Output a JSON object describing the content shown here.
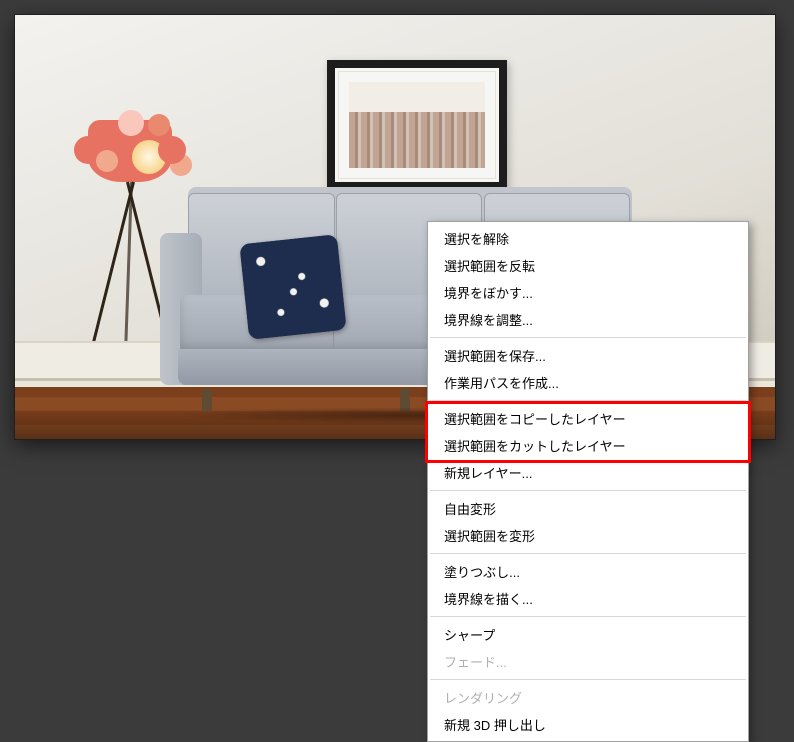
{
  "context_menu": {
    "items": [
      {
        "label": "選択を解除",
        "enabled": true,
        "sep_after": false
      },
      {
        "label": "選択範囲を反転",
        "enabled": true,
        "sep_after": false
      },
      {
        "label": "境界をぼかす...",
        "enabled": true,
        "sep_after": false
      },
      {
        "label": "境界線を調整...",
        "enabled": true,
        "sep_after": true
      },
      {
        "label": "選択範囲を保存...",
        "enabled": true,
        "sep_after": false
      },
      {
        "label": "作業用パスを作成...",
        "enabled": true,
        "sep_after": true
      },
      {
        "label": "選択範囲をコピーしたレイヤー",
        "enabled": true,
        "sep_after": false,
        "highlighted": true
      },
      {
        "label": "選択範囲をカットしたレイヤー",
        "enabled": true,
        "sep_after": false,
        "highlighted": true
      },
      {
        "label": "新規レイヤー...",
        "enabled": true,
        "sep_after": true
      },
      {
        "label": "自由変形",
        "enabled": true,
        "sep_after": false
      },
      {
        "label": "選択範囲を変形",
        "enabled": true,
        "sep_after": true
      },
      {
        "label": "塗りつぶし...",
        "enabled": true,
        "sep_after": false
      },
      {
        "label": "境界線を描く...",
        "enabled": true,
        "sep_after": true
      },
      {
        "label": "シャープ",
        "enabled": true,
        "sep_after": false
      },
      {
        "label": "フェード...",
        "enabled": false,
        "sep_after": true
      },
      {
        "label": "レンダリング",
        "enabled": false,
        "sep_after": false
      },
      {
        "label": "新規 3D 押し出し",
        "enabled": true,
        "sep_after": false
      }
    ]
  },
  "highlight_annotation": {
    "color": "#ff0000",
    "targets": [
      "選択範囲をコピーしたレイヤー",
      "選択範囲をカットしたレイヤー"
    ]
  }
}
